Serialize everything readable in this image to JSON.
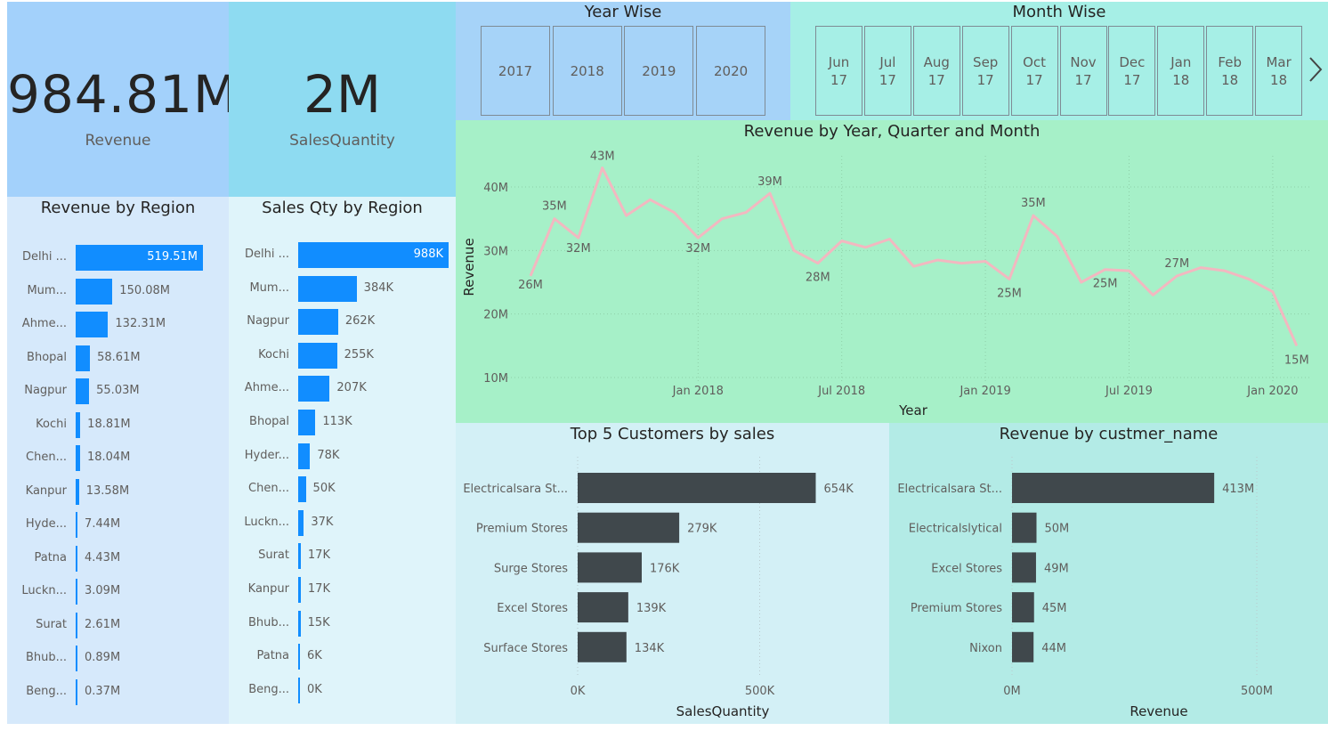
{
  "kpis": {
    "revenue": {
      "value": "984.81M",
      "label": "Revenue"
    },
    "quantity": {
      "value": "2M",
      "label": "SalesQuantity"
    }
  },
  "year_slicer": {
    "title": "Year Wise",
    "options": [
      "2017",
      "2018",
      "2019",
      "2020"
    ]
  },
  "month_slicer": {
    "title": "Month Wise",
    "options": [
      {
        "m": "Jun",
        "y": "17"
      },
      {
        "m": "Jul",
        "y": "17"
      },
      {
        "m": "Aug",
        "y": "17"
      },
      {
        "m": "Sep",
        "y": "17"
      },
      {
        "m": "Oct",
        "y": "17"
      },
      {
        "m": "Nov",
        "y": "17"
      },
      {
        "m": "Dec",
        "y": "17"
      },
      {
        "m": "Jan",
        "y": "18"
      },
      {
        "m": "Feb",
        "y": "18"
      },
      {
        "m": "Mar",
        "y": "18"
      }
    ],
    "next_icon": "chevron-right-icon"
  },
  "colors": {
    "bar_blue": "#118DFF",
    "bar_dark": "#40484C",
    "line": "#F2B8C0",
    "revenue_card_bg": "#A3D1FB",
    "qty_card_bg": "#8EDBF1",
    "region_rev_bg": "#D6E9FB",
    "region_qty_bg": "#DFF4FA",
    "year_bg": "#A6D3F8",
    "month_bg": "#A6EFE6",
    "line_chart_bg": "#A6F0C8",
    "top5_bg": "#D3F0F6",
    "cust_rev_bg": "#B3EBE6"
  },
  "chart_data": [
    {
      "type": "bar",
      "orientation": "horizontal",
      "title": "Revenue by Region",
      "categories": [
        "Delhi ...",
        "Mum...",
        "Ahme...",
        "Bhopal",
        "Nagpur",
        "Kochi",
        "Chen...",
        "Kanpur",
        "Hyde...",
        "Patna",
        "Luckn...",
        "Surat",
        "Bhub...",
        "Beng..."
      ],
      "values": [
        519.51,
        150.08,
        132.31,
        58.61,
        55.03,
        18.81,
        18.04,
        13.58,
        7.44,
        4.43,
        3.09,
        2.61,
        0.89,
        0.37
      ],
      "labels": [
        "519.51M",
        "150.08M",
        "132.31M",
        "58.61M",
        "55.03M",
        "18.81M",
        "18.04M",
        "13.58M",
        "7.44M",
        "4.43M",
        "3.09M",
        "2.61M",
        "0.89M",
        "0.37M"
      ]
    },
    {
      "type": "bar",
      "orientation": "horizontal",
      "title": "Sales Qty by Region",
      "categories": [
        "Delhi ...",
        "Mum...",
        "Nagpur",
        "Kochi",
        "Ahme...",
        "Bhopal",
        "Hyder...",
        "Chen...",
        "Luckn...",
        "Surat",
        "Kanpur",
        "Bhub...",
        "Patna",
        "Beng..."
      ],
      "values": [
        988,
        384,
        262,
        255,
        207,
        113,
        78,
        50,
        37,
        17,
        17,
        15,
        6,
        0
      ],
      "labels": [
        "988K",
        "384K",
        "262K",
        "255K",
        "207K",
        "113K",
        "78K",
        "50K",
        "37K",
        "17K",
        "17K",
        "15K",
        "6K",
        "0K"
      ]
    },
    {
      "type": "line",
      "title": "Revenue by Year, Quarter and Month",
      "xlabel": "Year",
      "ylabel": "Revenue",
      "x": [
        "2017-06",
        "2017-07",
        "2017-08",
        "2017-09",
        "2017-10",
        "2017-11",
        "2017-12",
        "2018-01",
        "2018-02",
        "2018-03",
        "2018-04",
        "2018-05",
        "2018-06",
        "2018-07",
        "2018-08",
        "2018-09",
        "2018-10",
        "2018-11",
        "2018-12",
        "2019-01",
        "2019-02",
        "2019-03",
        "2019-04",
        "2019-05",
        "2019-06",
        "2019-07",
        "2019-08",
        "2019-09",
        "2019-10",
        "2019-11",
        "2019-12",
        "2020-01",
        "2020-02",
        "2020-03",
        "2020-04",
        "2020-05",
        "2020-06"
      ],
      "values": [
        26,
        35,
        32,
        43,
        35.5,
        38,
        36,
        32,
        35,
        36,
        39,
        30,
        28,
        31.5,
        30.5,
        31.8,
        27.5,
        28.5,
        28,
        28.3,
        25.5,
        35.5,
        32.2,
        25,
        27,
        26.8,
        23,
        26,
        27.3,
        26.8,
        25.5,
        23.5,
        15
      ],
      "point_labels": [
        {
          "x": "2017-06",
          "label": "26M"
        },
        {
          "x": "2017-07",
          "label": "35M"
        },
        {
          "x": "2017-08",
          "label": "32M"
        },
        {
          "x": "2017-09",
          "label": "43M"
        },
        {
          "x": "2018-01",
          "label": "32M"
        },
        {
          "x": "2018-03",
          "label": "39M"
        },
        {
          "x": "2018-05",
          "label": "28M"
        },
        {
          "x": "2019-02",
          "label": "25M"
        },
        {
          "x": "2019-03",
          "label": "35M"
        },
        {
          "x": "2019-05",
          "label": "25M"
        },
        {
          "x": "2019-10",
          "label": "27M"
        },
        {
          "x": "2020-03",
          "label": "15M"
        }
      ],
      "y_ticks": [
        "10M",
        "20M",
        "30M",
        "40M"
      ],
      "x_ticks": [
        "Jan 2018",
        "Jul 2018",
        "Jan 2019",
        "Jul 2019",
        "Jan 2020"
      ],
      "ylim": [
        10,
        45
      ],
      "grid": true
    },
    {
      "type": "bar",
      "orientation": "horizontal",
      "title": "Top 5 Customers by sales",
      "xlabel": "SalesQuantity",
      "categories": [
        "Electricalsara St...",
        "Premium Stores",
        "Surge Stores",
        "Excel Stores",
        "Surface Stores"
      ],
      "values": [
        654,
        279,
        176,
        139,
        134
      ],
      "labels": [
        "654K",
        "279K",
        "176K",
        "139K",
        "134K"
      ],
      "x_ticks": [
        "0K",
        "500K"
      ],
      "xlim": [
        0,
        800
      ]
    },
    {
      "type": "bar",
      "orientation": "horizontal",
      "title": "Revenue by custmer_name",
      "xlabel": "Revenue",
      "categories": [
        "Electricalsara St...",
        "Electricalslytical",
        "Excel Stores",
        "Premium Stores",
        "Nixon"
      ],
      "values": [
        413,
        50,
        49,
        45,
        44
      ],
      "labels": [
        "413M",
        "50M",
        "49M",
        "45M",
        "44M"
      ],
      "x_ticks": [
        "0M",
        "500M"
      ],
      "xlim": [
        0,
        600
      ]
    }
  ]
}
